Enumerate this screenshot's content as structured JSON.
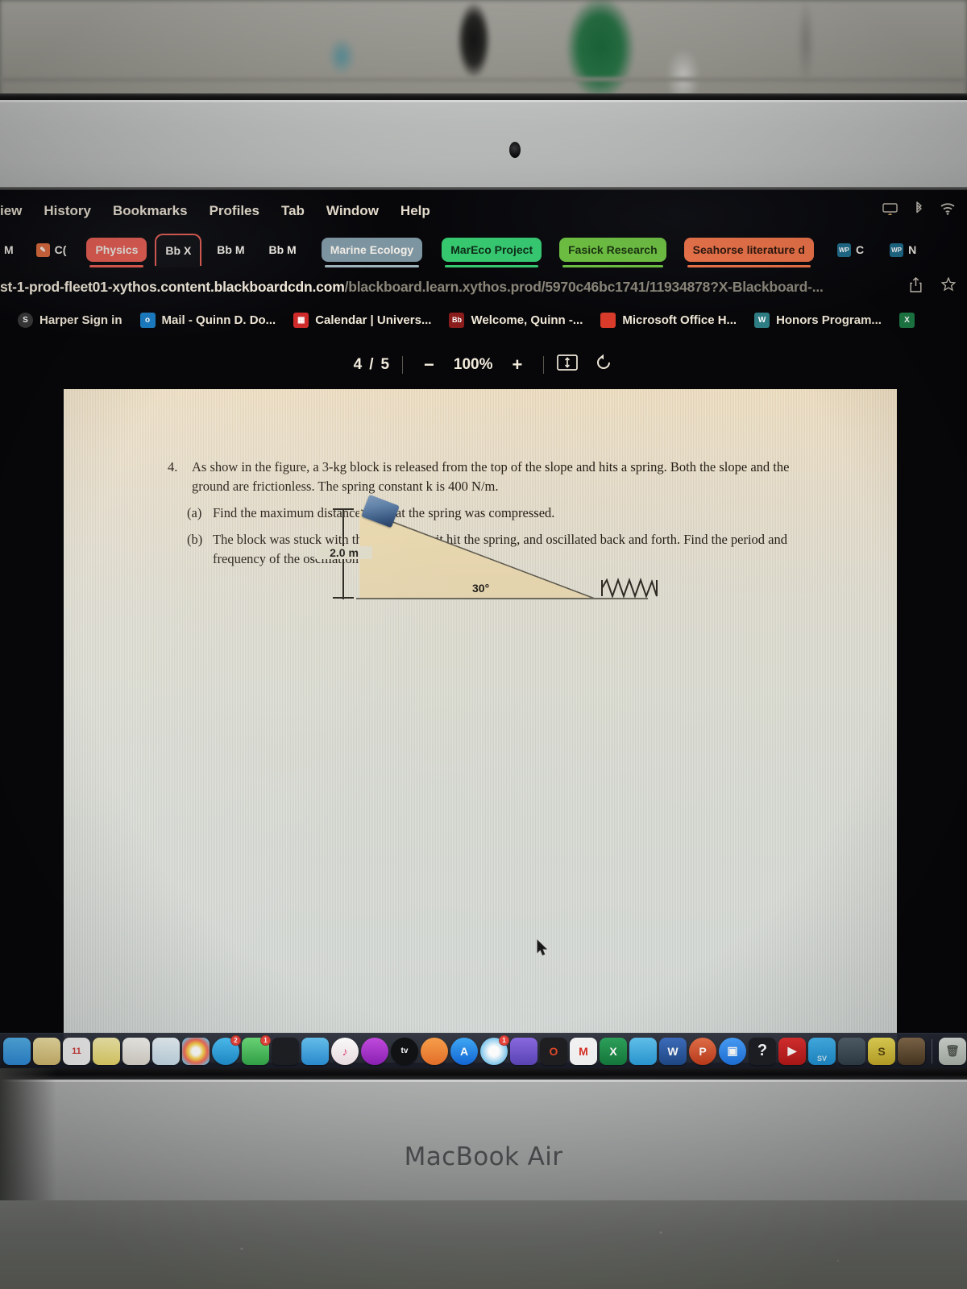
{
  "menubar": {
    "items": [
      "iew",
      "History",
      "Bookmarks",
      "Profiles",
      "Tab",
      "Window",
      "Help"
    ],
    "status_icons": [
      "airplay-icon",
      "bluetooth-icon",
      "wifi-icon"
    ]
  },
  "tabs": [
    {
      "label": "M",
      "favicon": "",
      "fav_color": "#1b1b1e",
      "color": "#1b1b1e",
      "underline": "",
      "active": false
    },
    {
      "label": "C(",
      "favicon": "pencil-icon",
      "fav_color": "#e06a3a",
      "color": "#1b1b1e",
      "underline": "",
      "active": false
    },
    {
      "label": "Physics",
      "favicon": "",
      "fav_color": "",
      "color": "#e8594c",
      "underline": "#e8594c",
      "active": false
    },
    {
      "label": "Bb  X",
      "favicon": "",
      "fav_color": "",
      "color": "",
      "underline": "",
      "active": true
    },
    {
      "label": "Bb  M",
      "favicon": "",
      "fav_color": "",
      "color": "",
      "underline": "",
      "active": false
    },
    {
      "label": "Bb  M",
      "favicon": "",
      "fav_color": "",
      "color": "",
      "underline": "",
      "active": false
    },
    {
      "label": "Marine Ecology",
      "favicon": "",
      "fav_color": "",
      "color": "#7d95a1",
      "underline": "#9fb3bd",
      "active": false
    },
    {
      "label": "MarEco Project",
      "favicon": "",
      "fav_color": "",
      "color": "#35c96f",
      "underline": "#35c96f",
      "active": false
    },
    {
      "label": "Fasick Research",
      "favicon": "",
      "fav_color": "",
      "color": "#6cc03e",
      "underline": "#6cc03e",
      "active": false
    },
    {
      "label": "Seahorse literature d",
      "favicon": "",
      "fav_color": "",
      "color": "#ef7246",
      "underline": "#ef7246",
      "active": false
    },
    {
      "label": "C",
      "favicon": "WP",
      "fav_color": "#1e6d8c",
      "color": "",
      "underline": "",
      "active": false
    },
    {
      "label": "N",
      "favicon": "WP",
      "fav_color": "#1e6d8c",
      "color": "",
      "underline": "",
      "active": false
    }
  ],
  "url": {
    "host": "st-1-prod-fleet01-xythos.content.blackboardcdn.com",
    "path": "/blackboard.learn.xythos.prod/5970c46bc1741/11934878?X-Blackboard-...",
    "share_icon": "share-icon",
    "bookmark_icon": "star-icon"
  },
  "bookmarks": [
    {
      "label": "Harper Sign in",
      "icon": "harper-icon",
      "icon_text": "S",
      "icon_color": "#3a3a3a"
    },
    {
      "label": "Mail - Quinn D. Do...",
      "icon": "outlook-icon",
      "icon_text": "o",
      "icon_color": "#1a7cc4"
    },
    {
      "label": "Calendar | Univers...",
      "icon": "calendar-icon",
      "icon_text": "",
      "icon_color": "#d02b2b"
    },
    {
      "label": "Welcome, Quinn -...",
      "icon": "blackboard-icon",
      "icon_text": "Bb",
      "icon_color": "#8a1c1c"
    },
    {
      "label": "Microsoft Office H...",
      "icon": "office-icon",
      "icon_text": "",
      "icon_color": "#d83b2a"
    },
    {
      "label": "Honors Program...",
      "icon": "wordpress-icon",
      "icon_text": "W",
      "icon_color": "#2e7e85"
    },
    {
      "label": "",
      "icon": "excel-icon",
      "icon_text": "",
      "icon_color": "#1d7a45"
    }
  ],
  "pdf_toolbar": {
    "page_current": "4",
    "page_sep": "/",
    "page_total": "5",
    "zoom_out": "−",
    "zoom_level": "100%",
    "zoom_in": "+",
    "fit_icon": "fit-page-icon",
    "rotate_icon": "rotate-icon"
  },
  "document": {
    "question_number": "4.",
    "stem": "As show in the figure, a 3-kg block is released from the top of the slope and hits a spring.  Both the slope and the ground are frictionless.  The spring constant k is 400 N/m.",
    "parts": [
      {
        "label": "(a)",
        "text": "Find the maximum distance Δ x that the spring was compressed."
      },
      {
        "label": "(b)",
        "text": "The block was stuck with the spring after it hit the spring, and oscillated back and forth.  Find the period and frequency of the oscillation."
      }
    ],
    "figure": {
      "height_label": "2.0 m",
      "angle_label": "30°",
      "block_name": "block",
      "spring_name": "spring",
      "ramp_color": "#e6d5ac",
      "block_color": "#3d5f8a"
    }
  },
  "dock": {
    "icons": [
      {
        "name": "finder-icon",
        "text": "",
        "color": "#2f8fe0",
        "badge": ""
      },
      {
        "name": "notes-icon",
        "text": "",
        "color": "#e0c060",
        "badge": ""
      },
      {
        "name": "calendar-app-icon",
        "text": "11",
        "color": "#f3f3f3",
        "badge": ""
      },
      {
        "name": "stickies-icon",
        "text": "",
        "color": "#f0e06a",
        "badge": ""
      },
      {
        "name": "contacts-icon",
        "text": "",
        "color": "#e9e9e4",
        "badge": ""
      },
      {
        "name": "preview-icon",
        "text": "",
        "color": "#d7e8f2",
        "badge": ""
      },
      {
        "name": "photos-icon",
        "text": "",
        "color": "#f5f5f5",
        "badge": ""
      },
      {
        "name": "messages-icon",
        "text": "",
        "color": "#2aa7e8",
        "badge": "2"
      },
      {
        "name": "numbers-icon",
        "text": "",
        "color": "#3fbf55",
        "badge": "1"
      },
      {
        "name": "charts-icon",
        "text": "",
        "color": "#1d1f24",
        "badge": ""
      },
      {
        "name": "keynote-icon",
        "text": "",
        "color": "#39a8e0",
        "badge": ""
      },
      {
        "name": "music-icon",
        "text": "",
        "color": "#f3f3f3",
        "badge": ""
      },
      {
        "name": "podcasts-icon",
        "text": "",
        "color": "#b02ed0",
        "badge": ""
      },
      {
        "name": "appletv-icon",
        "text": "tv",
        "color": "#111214",
        "badge": ""
      },
      {
        "name": "books-icon",
        "text": "",
        "color": "#f07a2e",
        "badge": ""
      },
      {
        "name": "appstore-icon",
        "text": "A",
        "color": "#1b8ff0",
        "badge": ""
      },
      {
        "name": "safari-icon",
        "text": "",
        "color": "#e7eef5",
        "badge": "1"
      },
      {
        "name": "discord-icon",
        "text": "",
        "color": "#6b5bd0",
        "badge": ""
      },
      {
        "name": "opera-icon",
        "text": "O",
        "color": "#1f1f22",
        "badge": ""
      },
      {
        "name": "gmail-icon",
        "text": "M",
        "color": "#d93025",
        "badge": ""
      },
      {
        "name": "excel-app-icon",
        "text": "X",
        "color": "#1d7a45",
        "badge": ""
      },
      {
        "name": "onedrive-icon",
        "text": "",
        "color": "#2a9ad6",
        "badge": ""
      },
      {
        "name": "word-icon",
        "text": "W",
        "color": "#2b579a",
        "badge": ""
      },
      {
        "name": "powerpoint-icon",
        "text": "P",
        "color": "#d24726",
        "badge": ""
      },
      {
        "name": "zoom-icon",
        "text": "",
        "color": "#2d8cff",
        "badge": ""
      },
      {
        "name": "help-icon",
        "text": "?",
        "color": "#1d1f24",
        "badge": ""
      },
      {
        "name": "youtube-icon",
        "text": "",
        "color": "#d02020",
        "badge": ""
      },
      {
        "name": "sv-icon",
        "text": "SV",
        "color": "#2ba3e0",
        "badge": ""
      },
      {
        "name": "molecule-icon",
        "text": "",
        "color": "#3a4a55",
        "badge": ""
      },
      {
        "name": "scratch-icon",
        "text": "S",
        "color": "#e8d84a",
        "badge": ""
      },
      {
        "name": "utility-icon",
        "text": "",
        "color": "#5a4a38",
        "badge": ""
      },
      {
        "name": "trash-icon",
        "text": "",
        "color": "#cfd6cf",
        "badge": ""
      }
    ]
  },
  "laptop": {
    "brand": "MacBook Air",
    "webcam": "webcam-icon"
  }
}
